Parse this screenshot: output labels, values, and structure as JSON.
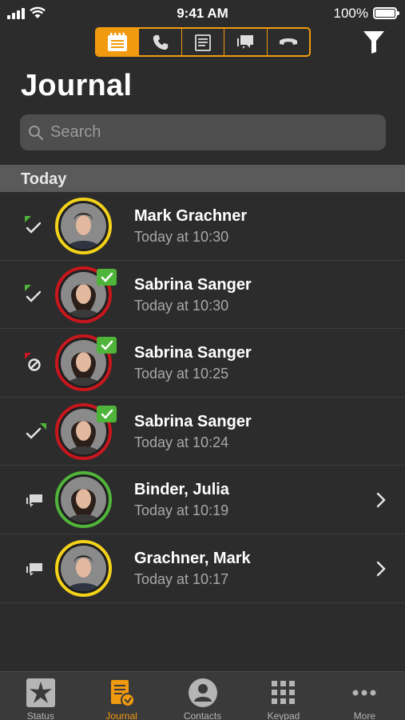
{
  "status_bar": {
    "time": "9:41 AM",
    "battery": "100%"
  },
  "segments": [
    {
      "icon": "journal-icon",
      "active": true
    },
    {
      "icon": "phone-icon",
      "active": false
    },
    {
      "icon": "notes-icon",
      "active": false
    },
    {
      "icon": "chat-icon",
      "active": false
    },
    {
      "icon": "voicemail-icon",
      "active": false
    }
  ],
  "page": {
    "title": "Journal"
  },
  "search": {
    "placeholder": "Search",
    "value": ""
  },
  "section": {
    "label": "Today"
  },
  "entries": [
    {
      "name": "Mark Grachner",
      "time": "Today at 10:30",
      "type": "outgoing-call",
      "ring": "yellow",
      "badge": false,
      "chevron": false
    },
    {
      "name": "Sabrina Sanger",
      "time": "Today at 10:30",
      "type": "outgoing-call",
      "ring": "red",
      "badge": true,
      "chevron": false
    },
    {
      "name": "Sabrina Sanger",
      "time": "Today at 10:25",
      "type": "missed-call",
      "ring": "red",
      "badge": true,
      "chevron": false
    },
    {
      "name": "Sabrina Sanger",
      "time": "Today at 10:24",
      "type": "incoming-call",
      "ring": "red",
      "badge": true,
      "chevron": false
    },
    {
      "name": "Binder, Julia",
      "time": "Today at 10:19",
      "type": "chat",
      "ring": "green",
      "badge": false,
      "chevron": true
    },
    {
      "name": "Grachner, Mark",
      "time": "Today at 10:17",
      "type": "chat",
      "ring": "yellow",
      "badge": false,
      "chevron": true
    }
  ],
  "tabs": [
    {
      "label": "Status",
      "icon": "status-star-icon",
      "active": false
    },
    {
      "label": "Journal",
      "icon": "journal-icon",
      "active": true
    },
    {
      "label": "Contacts",
      "icon": "person-icon",
      "active": false
    },
    {
      "label": "Keypad",
      "icon": "keypad-icon",
      "active": false
    },
    {
      "label": "More",
      "icon": "more-dots-icon",
      "active": false
    }
  ],
  "colors": {
    "accent": "#f19a0f",
    "present": "#51b43a",
    "busy": "#c7171d",
    "away": "#f4d21a"
  }
}
